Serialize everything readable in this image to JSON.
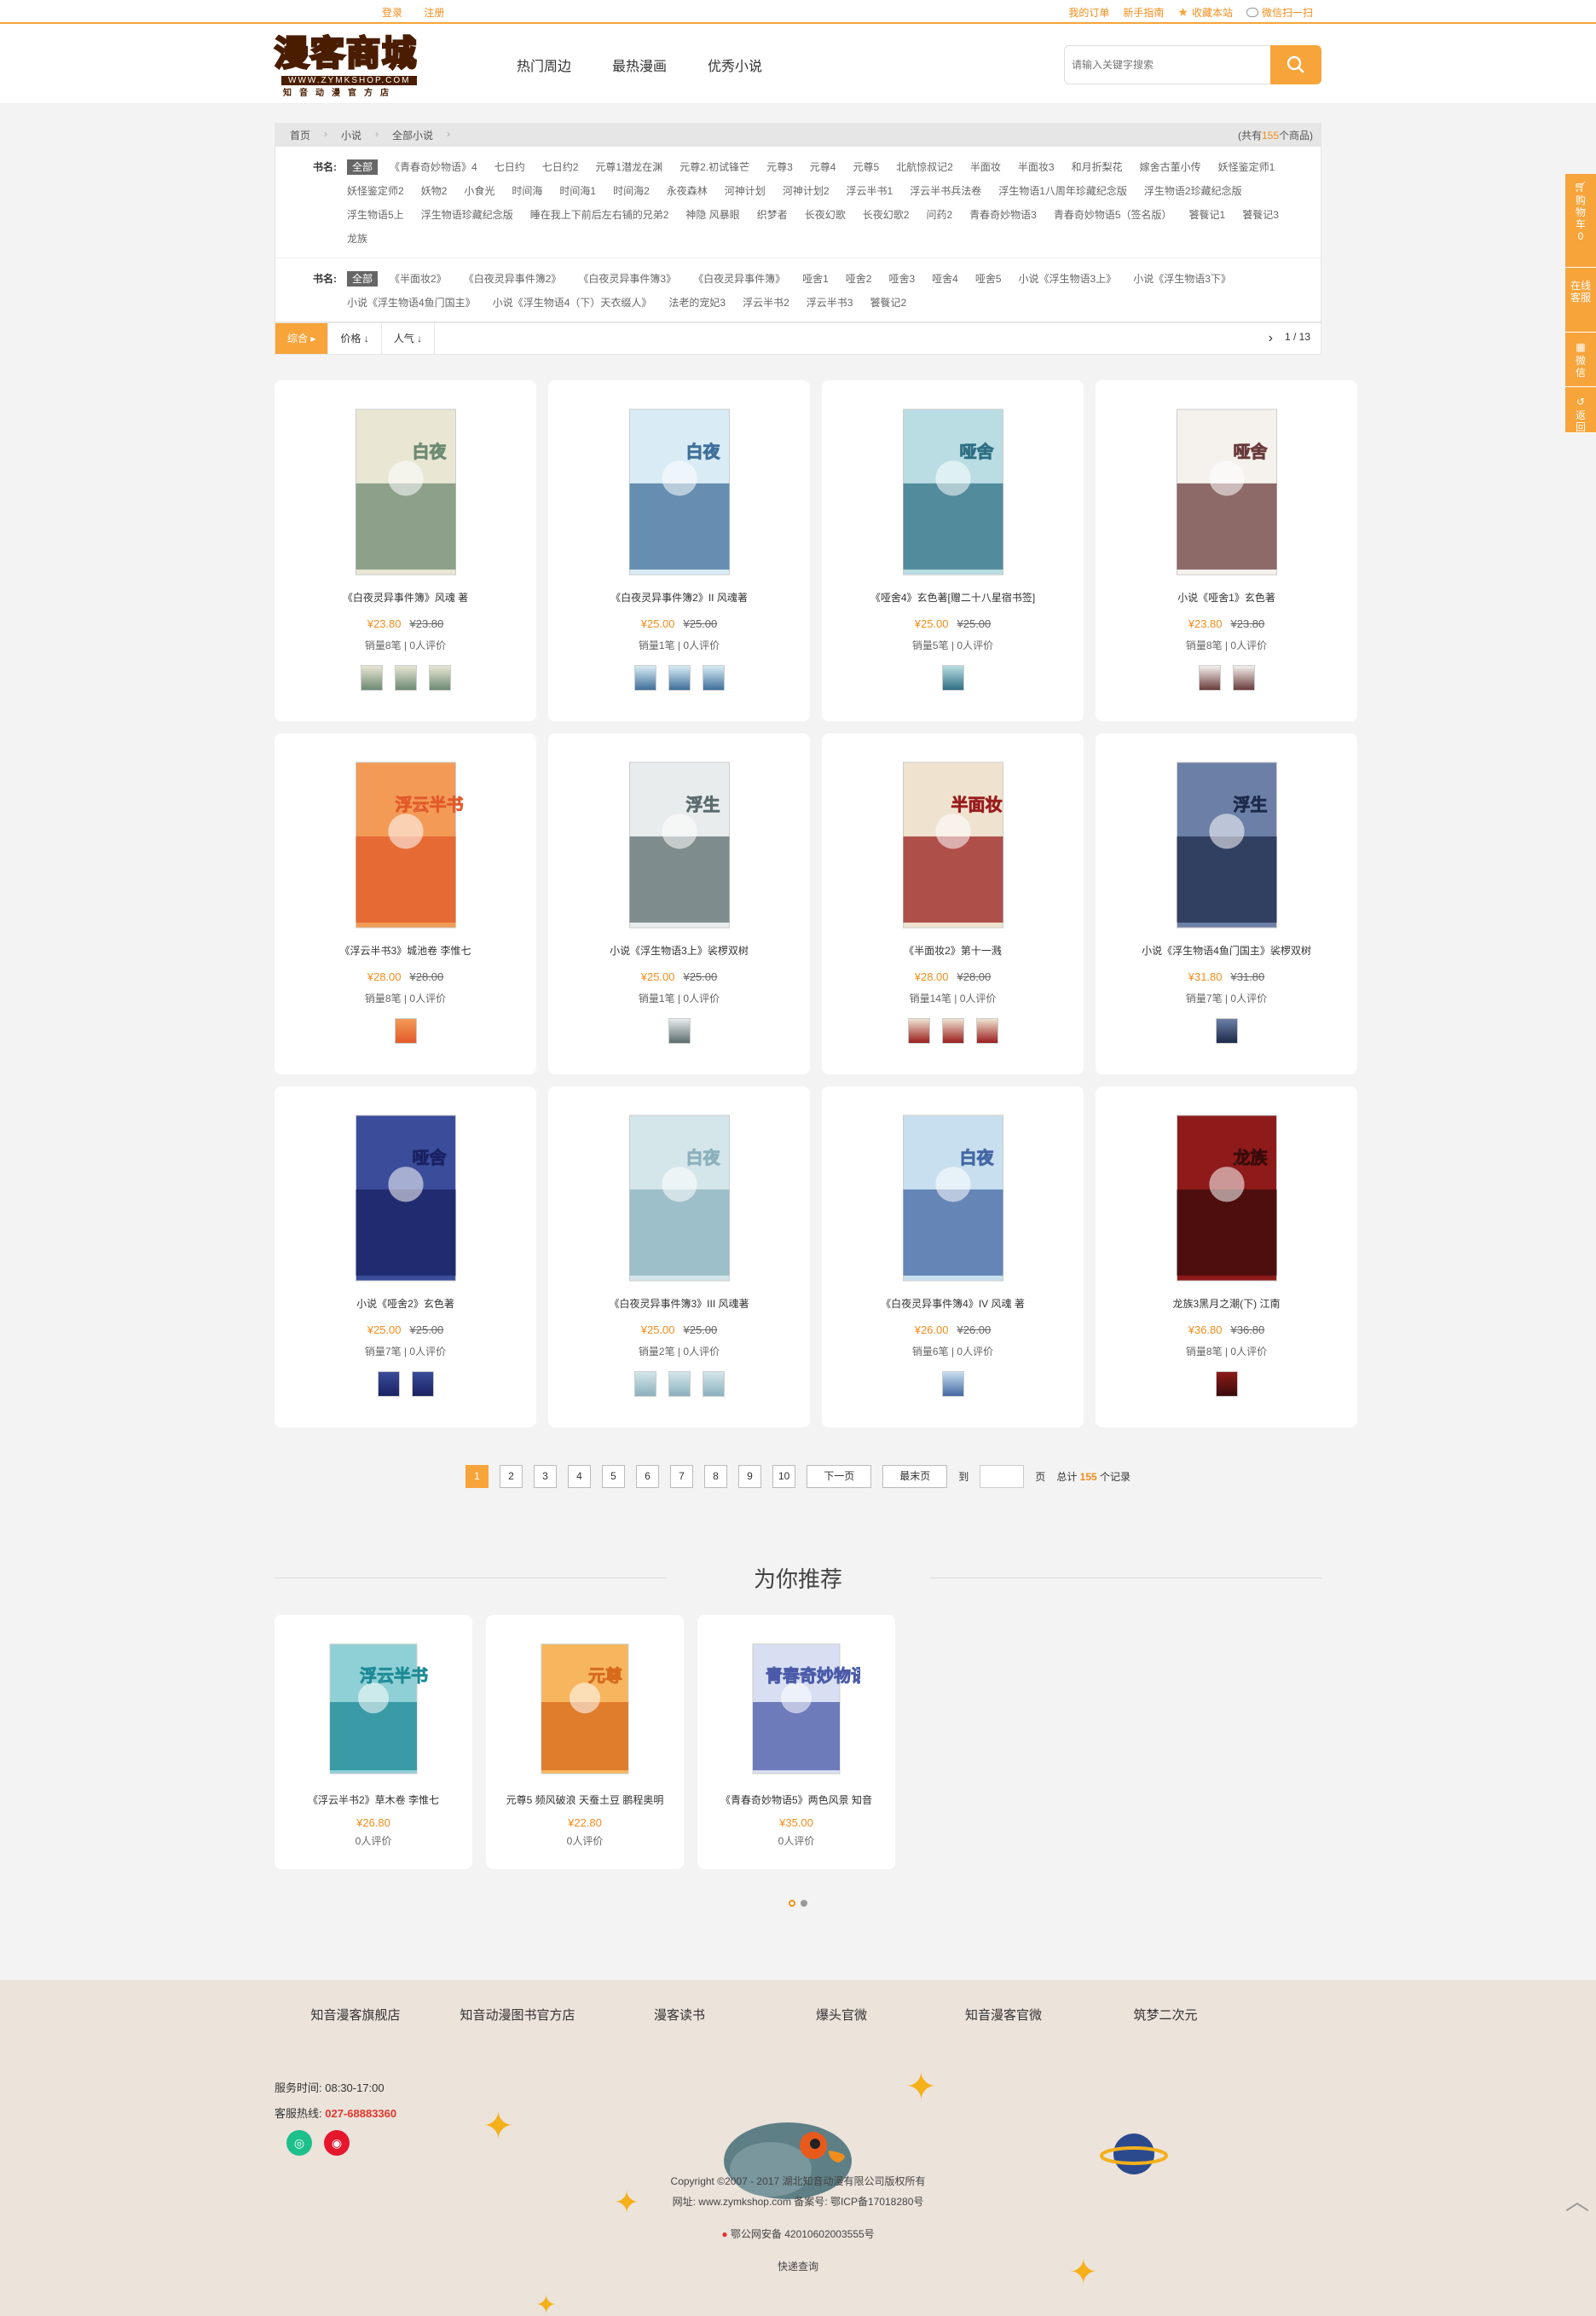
{
  "topbar": {
    "login": "登录",
    "register": "注册",
    "my_orders": "我的订单",
    "guide": "新手指南",
    "bookmark": "收藏本站",
    "wechat": "微信扫一扫"
  },
  "header": {
    "logo_text": "漫客商城",
    "logo_url": "WWW.ZYMKSHOP.COM",
    "logo_sub": "知音动漫官方店",
    "nav": [
      "热门周边",
      "最热漫画",
      "优秀小说"
    ],
    "search_placeholder": "请输入关键字搜索"
  },
  "breadcrumb": {
    "items": [
      "首页",
      "小说",
      "全部小说"
    ],
    "total_prefix": "(共有",
    "total_count": "155",
    "total_suffix": "个商品)"
  },
  "filters": [
    {
      "label": "书名:",
      "options": [
        "全部",
        "《青春奇妙物语》4",
        "七日约",
        "七日约2",
        "元尊1潜龙在渊",
        "元尊2.初试锋芒",
        "元尊3",
        "元尊4",
        "元尊5",
        "北航惊叔记2",
        "半面妆",
        "半面妆3",
        "和月折梨花",
        "嫁舍古董小传",
        "妖怪鉴定师1",
        "妖怪鉴定师2",
        "妖物2",
        "小食光",
        "时间海",
        "时间海1",
        "时间海2",
        "永夜森林",
        "河神计划",
        "河神计划2",
        "浮云半书1",
        "浮云半书兵法卷",
        "浮生物语1八周年珍藏纪念版",
        "浮生物语2珍藏纪念版",
        "浮生物语5上",
        "浮生物语珍藏纪念版",
        "睡在我上下前后左右铺的兄弟2",
        "神隐 风暴眼",
        "织梦者",
        "长夜幻歌",
        "长夜幻歌2",
        "问药2",
        "青春奇妙物语3",
        "青春奇妙物语5（签名版）",
        "饕餮记1",
        "饕餮记3",
        "龙族"
      ]
    },
    {
      "label": "书名:",
      "options": [
        "全部",
        "《半面妆2》",
        "《白夜灵异事件簿2》",
        "《白夜灵异事件簿3》",
        "《白夜灵异事件簿》",
        "哑舍1",
        "哑舍2",
        "哑舍3",
        "哑舍4",
        "哑舍5",
        "小说《浮生物语3上》",
        "小说《浮生物语3下》",
        "小说《浮生物语4鱼门国主》",
        "小说《浮生物语4（下）天衣缀人》",
        "法老的宠妃3",
        "浮云半书2",
        "浮云半书3",
        "饕餮记2"
      ]
    }
  ],
  "sortbar": {
    "items": [
      "综合",
      "价格",
      "人气"
    ],
    "page_info": "1 / 13"
  },
  "products": [
    {
      "name": "《白夜灵异事件簿》风魂 著",
      "price": "¥23.80",
      "orig": "¥23.80",
      "sales": "销量8笔",
      "reviews": "0人评价",
      "thumbs": 3,
      "c1": "#e9e6d4",
      "c2": "#6d8a72",
      "text": "白夜"
    },
    {
      "name": "《白夜灵异事件簿2》II 风魂著",
      "price": "¥25.00",
      "orig": "¥25.00",
      "sales": "销量1笔",
      "reviews": "0人评价",
      "thumbs": 3,
      "c1": "#d9ecf5",
      "c2": "#3e6f9a",
      "text": "白夜"
    },
    {
      "name": "《哑舍4》玄色著[赠二十八星宿书签]",
      "price": "¥25.00",
      "orig": "¥25.00",
      "sales": "销量5笔",
      "reviews": "0人评价",
      "thumbs": 1,
      "c1": "#b9dde3",
      "c2": "#2f6f84",
      "text": "哑舍"
    },
    {
      "name": "小说《哑舍1》玄色著",
      "price": "¥23.80",
      "orig": "¥23.80",
      "sales": "销量8笔",
      "reviews": "0人评价",
      "thumbs": 2,
      "c1": "#f5f2ee",
      "c2": "#6a3b3b",
      "text": "哑舍"
    },
    {
      "name": "《浮云半书3》城池卷 李惟七",
      "price": "¥28.00",
      "orig": "¥28.00",
      "sales": "销量8笔",
      "reviews": "0人评价",
      "thumbs": 1,
      "c1": "#f39a56",
      "c2": "#e25a2a",
      "text": "浮云半书"
    },
    {
      "name": "小说《浮生物语3上》裟椤双树",
      "price": "¥25.00",
      "orig": "¥25.00",
      "sales": "销量1笔",
      "reviews": "0人评价",
      "thumbs": 1,
      "c1": "#e8ecec",
      "c2": "#5c6c6e",
      "text": "浮生"
    },
    {
      "name": "《半面妆2》第十一溅",
      "price": "¥28.00",
      "orig": "¥28.00",
      "sales": "销量14笔",
      "reviews": "0人评价",
      "thumbs": 3,
      "c1": "#efe3d0",
      "c2": "#9a1d1d",
      "text": "半面妆"
    },
    {
      "name": "小说《浮生物语4鱼门国主》裟椤双树",
      "price": "¥31.80",
      "orig": "¥31.80",
      "sales": "销量7笔",
      "reviews": "0人评价",
      "thumbs": 1,
      "c1": "#6c7fa6",
      "c2": "#1d2a4a",
      "text": "浮生"
    },
    {
      "name": "小说《哑舍2》玄色著",
      "price": "¥25.00",
      "orig": "¥25.00",
      "sales": "销量7笔",
      "reviews": "0人评价",
      "thumbs": 2,
      "c1": "#3a4c9a",
      "c2": "#1a2262",
      "text": "哑舍"
    },
    {
      "name": "《白夜灵异事件簿3》III 风魂著",
      "price": "¥25.00",
      "orig": "¥25.00",
      "sales": "销量2笔",
      "reviews": "0人评价",
      "thumbs": 3,
      "c1": "#d4e6ea",
      "c2": "#8bb1bd",
      "text": "白夜"
    },
    {
      "name": "《白夜灵异事件簿4》IV 风魂 著",
      "price": "¥26.00",
      "orig": "¥26.00",
      "sales": "销量6笔",
      "reviews": "0人评价",
      "thumbs": 1,
      "c1": "#c8dff0",
      "c2": "#4467a3",
      "text": "白夜"
    },
    {
      "name": "龙族3黑月之潮(下) 江南",
      "price": "¥36.80",
      "orig": "¥36.80",
      "sales": "销量8笔",
      "reviews": "0人评价",
      "thumbs": 1,
      "c1": "#8e1a1a",
      "c2": "#3a0b0b",
      "text": "龙族"
    }
  ],
  "pager": {
    "pages": [
      "1",
      "2",
      "3",
      "4",
      "5",
      "6",
      "7",
      "8",
      "9",
      "10"
    ],
    "next": "下一页",
    "last": "最末页",
    "goto_prefix": "到",
    "goto_suffix": "页",
    "total_prefix": "总计",
    "total_count": "155",
    "total_suffix": "个记录"
  },
  "recommend": {
    "title": "为你推荐",
    "items": [
      {
        "name": "《浮云半书2》草木卷 李惟七",
        "price": "¥26.80",
        "reviews": "0人评价",
        "c1": "#8fd0d6",
        "c2": "#1d8a96",
        "text": "浮云半书"
      },
      {
        "name": "元尊5 频风破浪 天蚕土豆 鹏程奥明",
        "price": "¥22.80",
        "reviews": "0人评价",
        "c1": "#f7b65d",
        "c2": "#d86a1e",
        "text": "元尊"
      },
      {
        "name": "《青春奇妙物语5》两色风景 知音",
        "price": "¥35.00",
        "reviews": "0人评价",
        "c1": "#d8dff2",
        "c2": "#4b5aa8",
        "text": "青春奇妙物语"
      }
    ]
  },
  "footer": {
    "links": [
      "知音漫客旗舰店",
      "知音动漫图书官方店",
      "漫客读书",
      "爆头官微",
      "知音漫客官微",
      "筑梦二次元"
    ],
    "service_time_label": "服务时间:",
    "service_time": "08:30-17:00",
    "hotline_label": "客服热线:",
    "hotline": "027-68883360",
    "copyright": "Copyright ©2007 - 2017 湖北知音动漫有限公司版权所有",
    "address": "网址: www.zymkshop.com 备案号: 鄂ICP备17018280号",
    "beian": "鄂公网安备 42010602003555号",
    "quick": "快递查询"
  },
  "sidebar": {
    "cart": "购物车",
    "cart_count": "0",
    "service": "在线客服",
    "wechat": "微信",
    "back": "返回"
  },
  "colors": {
    "accent": "#f7a43b",
    "price": "#f28d1b"
  }
}
